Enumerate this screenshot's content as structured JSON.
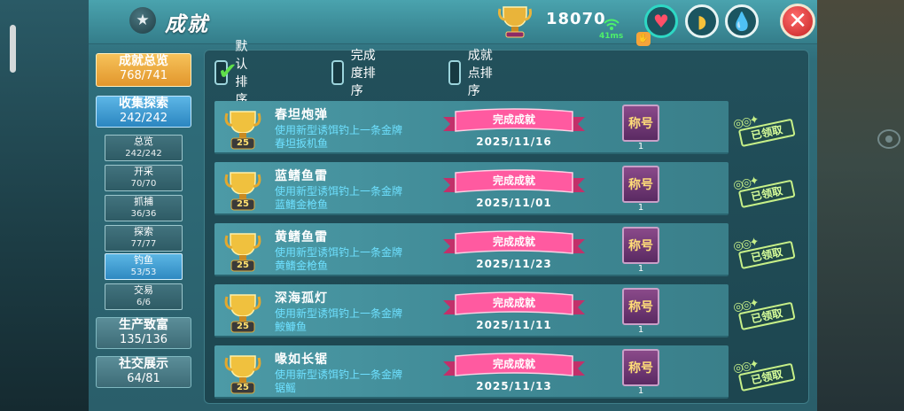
{
  "header": {
    "title": "成就",
    "points": "18070",
    "ping": "41ms"
  },
  "sidebar": {
    "overview": {
      "label": "成就总览",
      "count": "768/741"
    },
    "collect": {
      "label": "收集探索",
      "count": "242/242"
    },
    "subs": [
      {
        "label": "总览",
        "count": "242/242"
      },
      {
        "label": "开采",
        "count": "70/70"
      },
      {
        "label": "抓捕",
        "count": "36/36"
      },
      {
        "label": "探索",
        "count": "77/77"
      },
      {
        "label": "钓鱼",
        "count": "53/53",
        "active": true
      },
      {
        "label": "交易",
        "count": "6/6"
      }
    ],
    "wealth": {
      "label": "生产致富",
      "count": "135/136"
    },
    "social": {
      "label": "社交展示",
      "count": "64/81"
    }
  },
  "sort": {
    "default": "默认排序",
    "completion": "完成度排序",
    "points": "成就点排序"
  },
  "rows": [
    {
      "title": "春坦炮弹",
      "desc1": "使用新型诱饵钓上一条金牌",
      "desc2": "春坦扳机鱼",
      "status": "完成成就",
      "date": "2025/11/16",
      "points": "25",
      "badge": "称号",
      "badge_count": "1",
      "claim": "已领取"
    },
    {
      "title": "蓝鳍鱼雷",
      "desc1": "使用新型诱饵钓上一条金牌",
      "desc2": "蓝鳍金枪鱼",
      "status": "完成成就",
      "date": "2025/11/01",
      "points": "25",
      "badge": "称号",
      "badge_count": "1",
      "claim": "已领取"
    },
    {
      "title": "黄鳍鱼雷",
      "desc1": "使用新型诱饵钓上一条金牌",
      "desc2": "黄鳍金枪鱼",
      "status": "完成成就",
      "date": "2025/11/23",
      "points": "25",
      "badge": "称号",
      "badge_count": "1",
      "claim": "已领取"
    },
    {
      "title": "深海孤灯",
      "desc1": "使用新型诱饵钓上一条金牌",
      "desc2": "鮟鱇鱼",
      "status": "完成成就",
      "date": "2025/11/11",
      "points": "25",
      "badge": "称号",
      "badge_count": "1",
      "claim": "已领取"
    },
    {
      "title": "喙如长锯",
      "desc1": "使用新型诱饵钓上一条金牌",
      "desc2": "锯鳐",
      "status": "完成成就",
      "date": "2025/11/13",
      "points": "25",
      "badge": "称号",
      "badge_count": "1",
      "claim": "已领取"
    }
  ]
}
